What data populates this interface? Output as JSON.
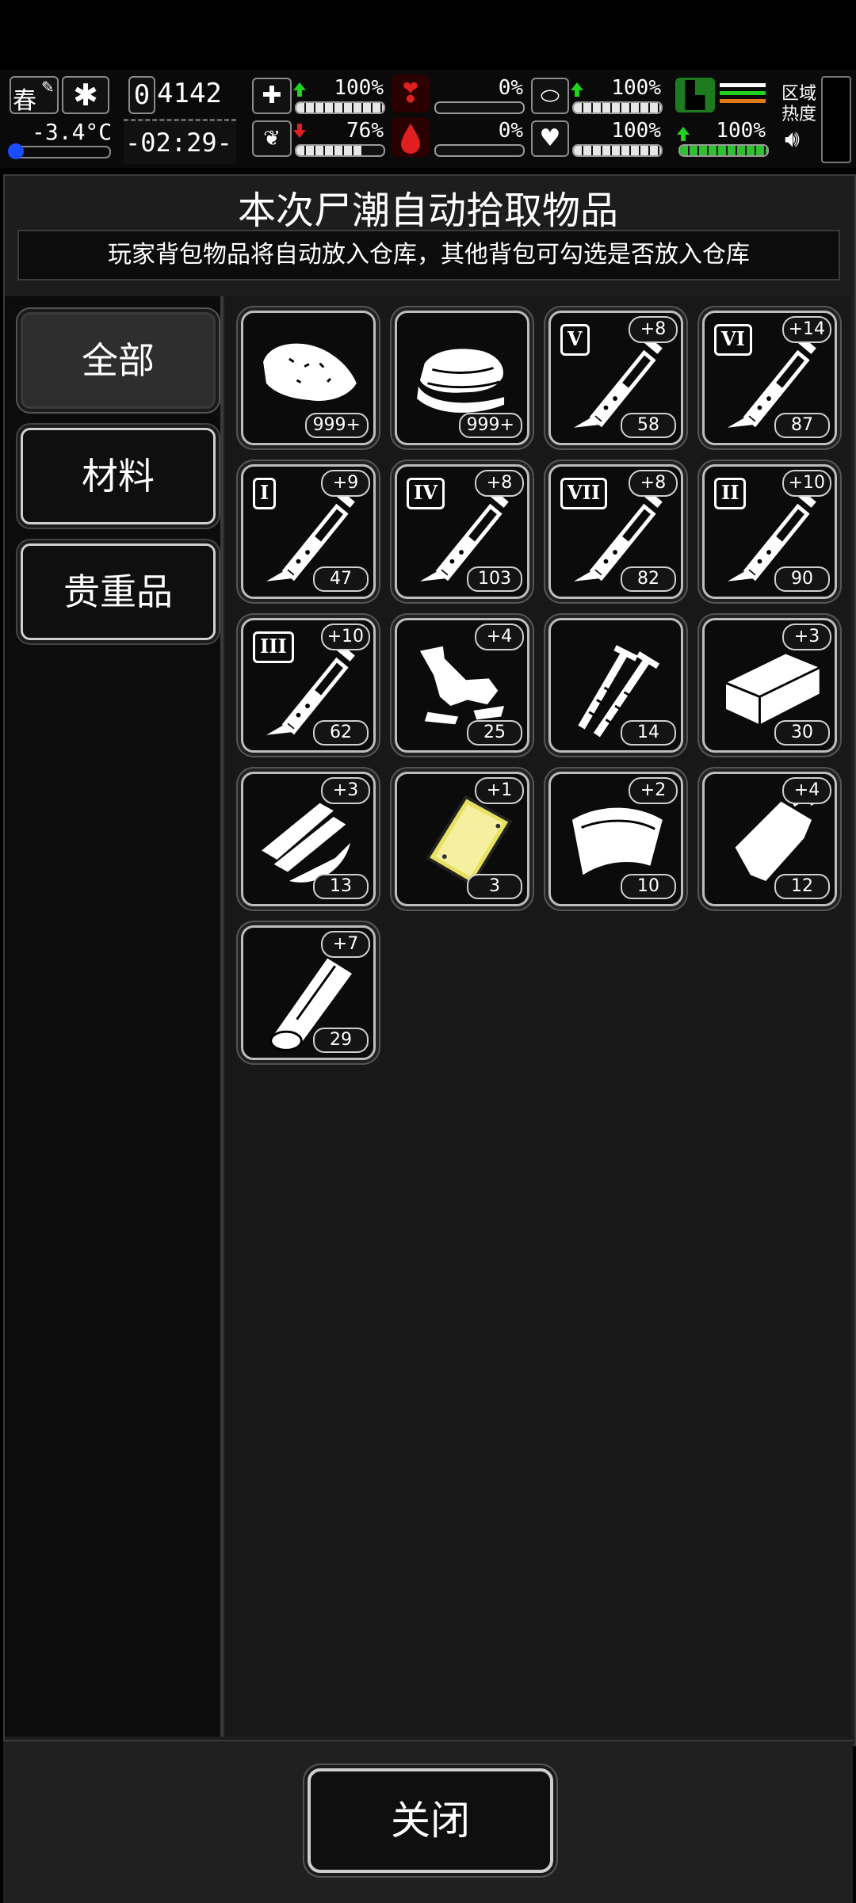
{
  "status": {
    "season": "春",
    "temperature": "-3.4°C",
    "day_counter": "4142",
    "day_prefix": "0",
    "clock": "-02:29-",
    "health_pct": "100%",
    "sanity_pct": "76%",
    "hunger_pct": "0%",
    "blood_pct": "0%",
    "immunity_pct": "100%",
    "heart_pct": "100%",
    "stamina_pct": "100%",
    "zone_heat_label": "区域热度"
  },
  "dialog": {
    "title": "本次尸潮自动拾取物品",
    "subtitle": "玩家背包物品将自动放入仓库，其他背包可勾选是否放入仓库"
  },
  "tabs": [
    {
      "label": "全部",
      "active": true
    },
    {
      "label": "材料",
      "active": false
    },
    {
      "label": "贵重品",
      "active": false
    }
  ],
  "items": [
    {
      "icon": "meat-icon",
      "count": "999+",
      "bonus": "",
      "roman": ""
    },
    {
      "icon": "cloth-icon",
      "count": "999+",
      "bonus": "",
      "roman": ""
    },
    {
      "icon": "syringe-icon",
      "count": "58",
      "bonus": "+8",
      "roman": "V"
    },
    {
      "icon": "syringe-icon",
      "count": "87",
      "bonus": "+14",
      "roman": "VI"
    },
    {
      "icon": "syringe-icon",
      "count": "47",
      "bonus": "+9",
      "roman": "I"
    },
    {
      "icon": "syringe-icon",
      "count": "103",
      "bonus": "+8",
      "roman": "IV"
    },
    {
      "icon": "syringe-icon",
      "count": "82",
      "bonus": "+8",
      "roman": "VII"
    },
    {
      "icon": "syringe-icon",
      "count": "90",
      "bonus": "+10",
      "roman": "II"
    },
    {
      "icon": "syringe-icon",
      "count": "62",
      "bonus": "+10",
      "roman": "III"
    },
    {
      "icon": "scrap-metal-icon",
      "count": "25",
      "bonus": "+4",
      "roman": ""
    },
    {
      "icon": "screws-icon",
      "count": "14",
      "bonus": "",
      "roman": ""
    },
    {
      "icon": "brick-icon",
      "count": "30",
      "bonus": "+3",
      "roman": ""
    },
    {
      "icon": "wood-planks-icon",
      "count": "13",
      "bonus": "+3",
      "roman": ""
    },
    {
      "icon": "gold-plate-icon",
      "count": "3",
      "bonus": "+1",
      "roman": ""
    },
    {
      "icon": "leather-icon",
      "count": "10",
      "bonus": "+2",
      "roman": ""
    },
    {
      "icon": "bag-icon",
      "count": "12",
      "bonus": "+4",
      "roman": ""
    },
    {
      "icon": "log-icon",
      "count": "29",
      "bonus": "+7",
      "roman": ""
    }
  ],
  "close_label": "关闭",
  "colors": {
    "green": "#22d022",
    "red": "#e02020",
    "orange": "#e07a1c",
    "gold": "#e8e060"
  }
}
